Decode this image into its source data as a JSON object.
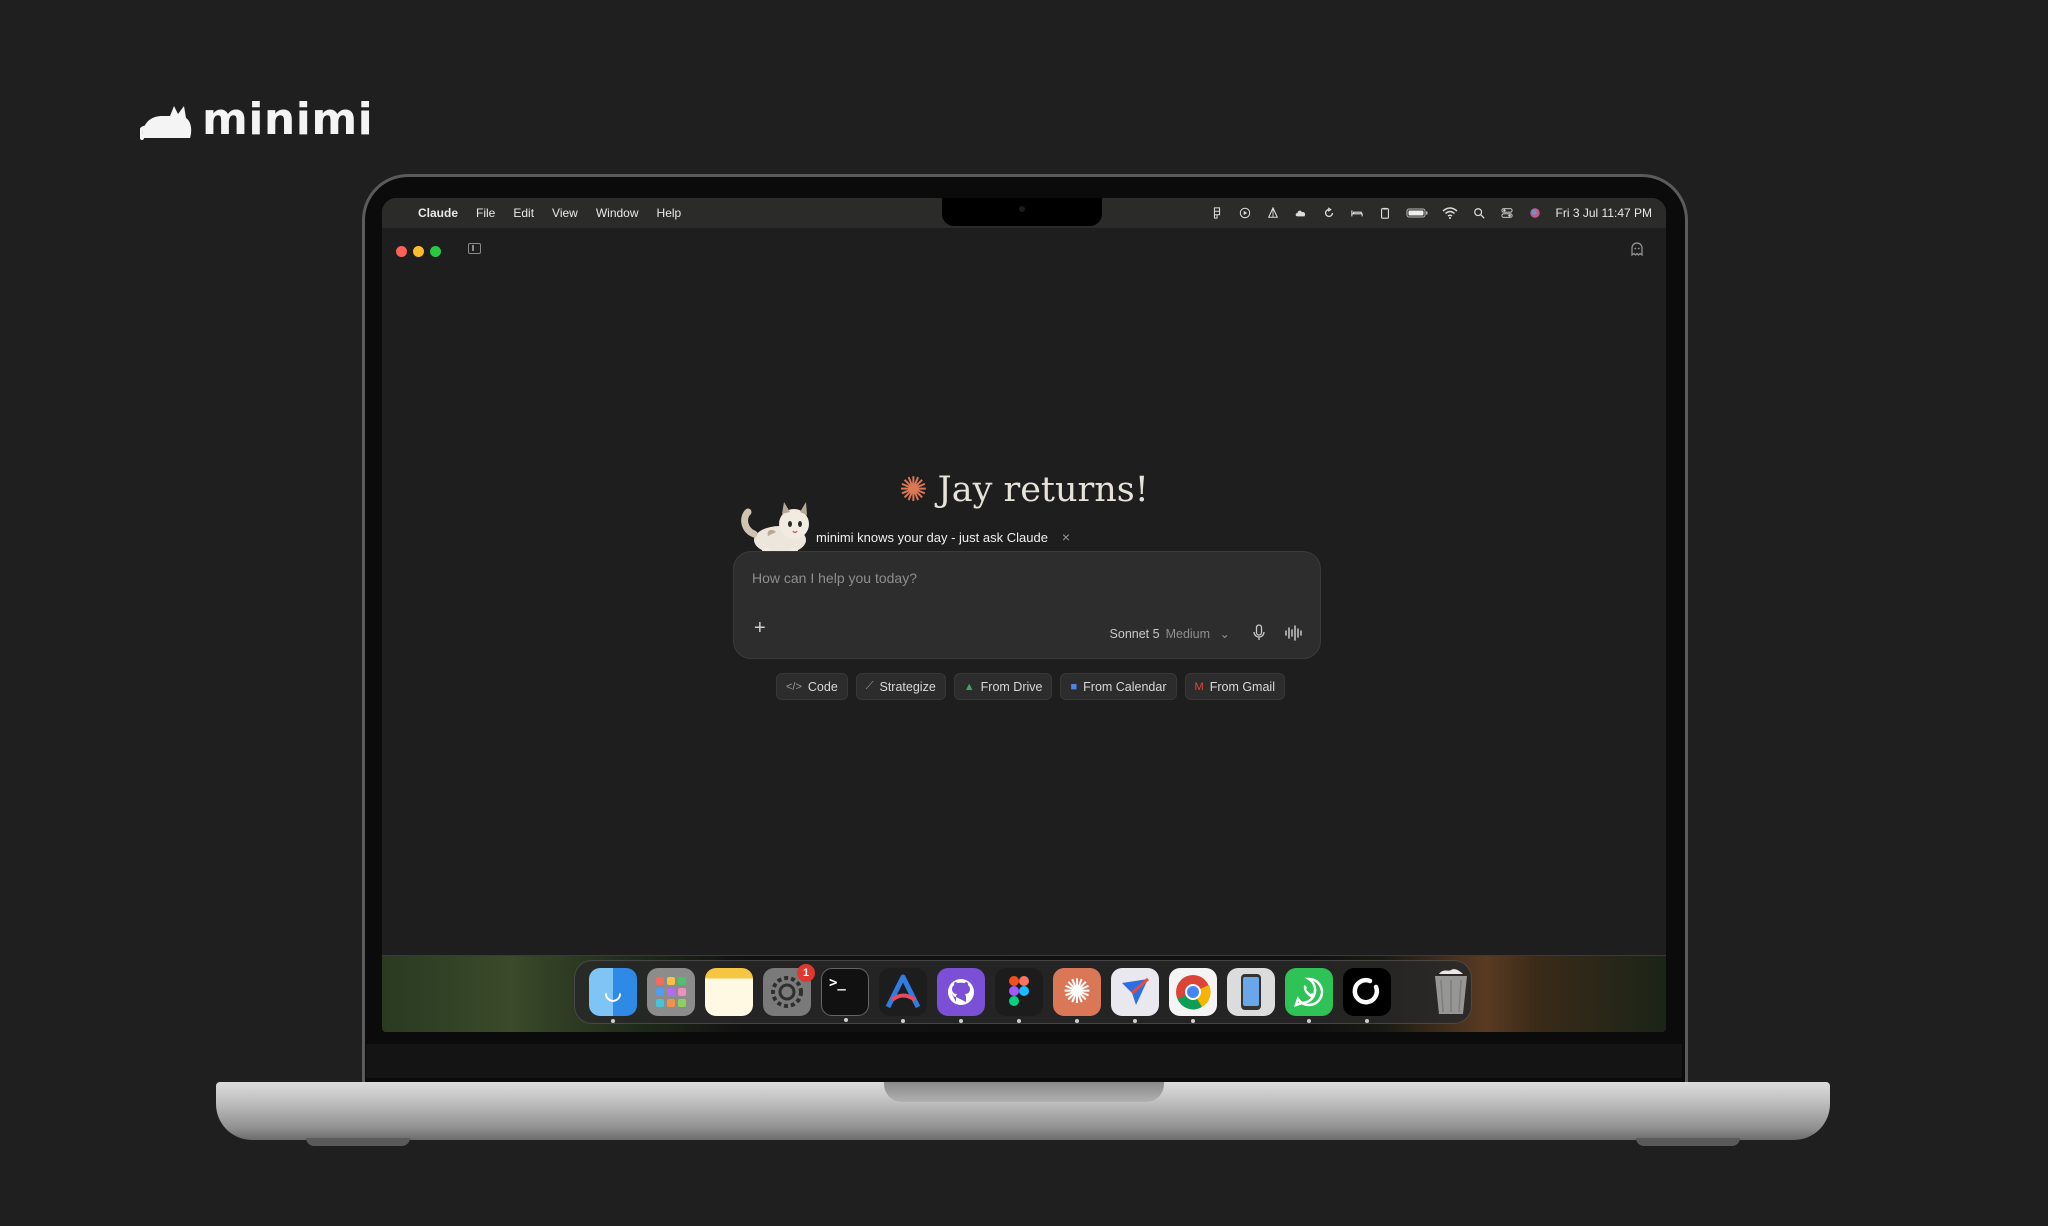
{
  "brand": {
    "name": "minimi"
  },
  "menubar": {
    "app_name": "Claude",
    "menus": [
      "File",
      "Edit",
      "View",
      "Window",
      "Help"
    ],
    "datetime": "Fri 3 Jul  11:47 PM",
    "status_icons": [
      "figma-icon",
      "play-icon",
      "sail-icon",
      "cloud-icon",
      "sync-icon",
      "bed-icon",
      "clipboard-icon",
      "battery-icon",
      "wifi-icon",
      "search-icon",
      "control-center-icon",
      "siri-icon"
    ]
  },
  "window": {
    "traffic_lights": {
      "close": "#ff5f57",
      "minimize": "#febc2e",
      "zoom": "#28c840"
    }
  },
  "main": {
    "greeting": "Jay returns!",
    "spark_color": "#d97757",
    "tip_text": "minimi knows your day - just ask Claude",
    "tip_close": "×",
    "composer": {
      "placeholder": "How can I help you today?",
      "model": "Sonnet 5",
      "effort": "Medium"
    },
    "chips": [
      {
        "label": "Code",
        "icon": "code-icon"
      },
      {
        "label": "Strategize",
        "icon": "chart-icon"
      },
      {
        "label": "From Drive",
        "icon": "drive-icon"
      },
      {
        "label": "From Calendar",
        "icon": "calendar-icon"
      },
      {
        "label": "From Gmail",
        "icon": "gmail-icon"
      }
    ]
  },
  "dock": {
    "apps": [
      {
        "name": "Finder",
        "icon": "finder-icon"
      },
      {
        "name": "Launchpad",
        "icon": "launchpad-icon"
      },
      {
        "name": "Notes",
        "icon": "notes-icon"
      },
      {
        "name": "System Settings",
        "icon": "settings-icon",
        "badge": "1"
      },
      {
        "name": "Terminal",
        "icon": "terminal-icon"
      },
      {
        "name": "Arc",
        "icon": "arc-icon"
      },
      {
        "name": "GitHub Desktop",
        "icon": "github-icon"
      },
      {
        "name": "Figma",
        "icon": "figma-icon"
      },
      {
        "name": "Claude",
        "icon": "claude-icon"
      },
      {
        "name": "Spark",
        "icon": "spark-mail-icon"
      },
      {
        "name": "Chrome",
        "icon": "chrome-icon"
      },
      {
        "name": "Simulator",
        "icon": "simulator-icon"
      },
      {
        "name": "WhatsApp",
        "icon": "whatsapp-icon"
      },
      {
        "name": "Loop",
        "icon": "loop-icon"
      },
      {
        "name": "Trash",
        "icon": "trash-icon"
      }
    ]
  }
}
